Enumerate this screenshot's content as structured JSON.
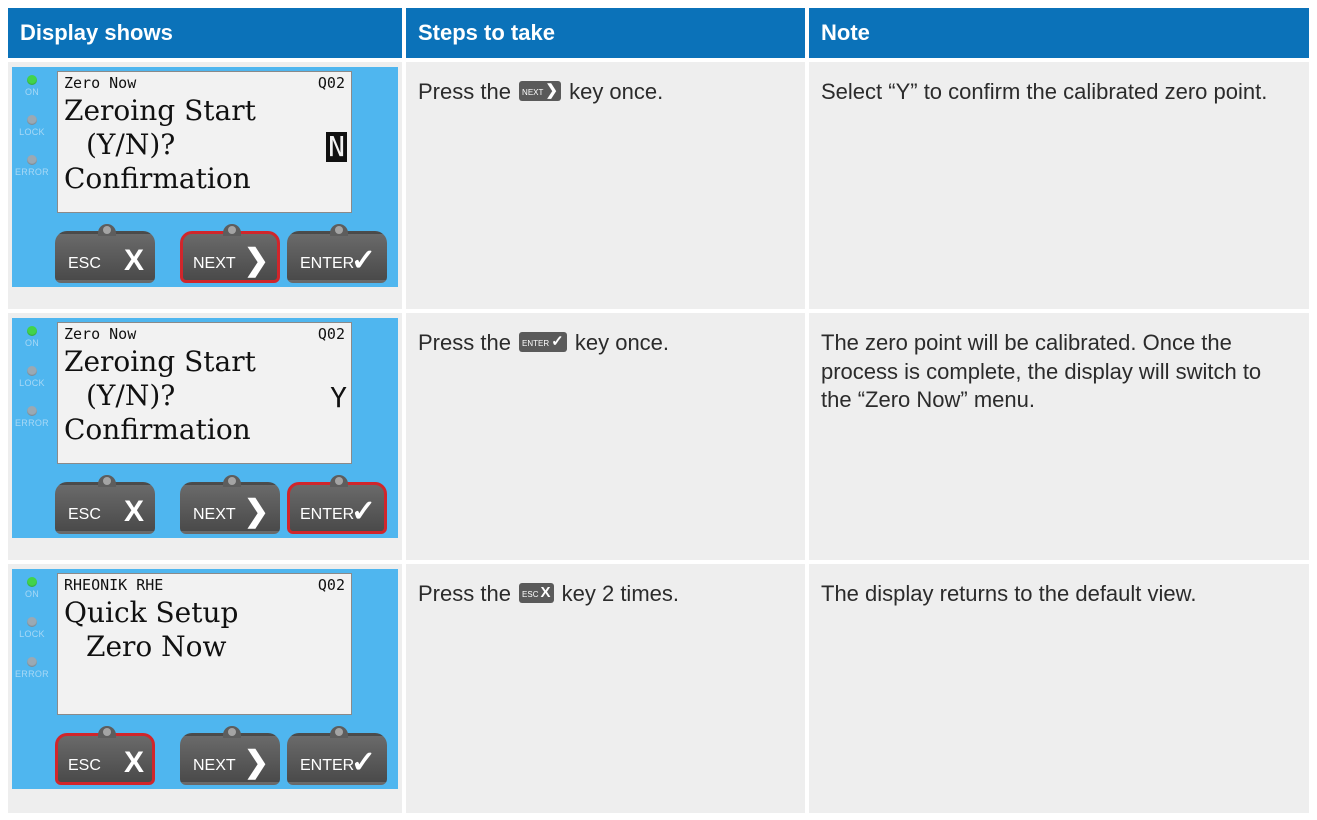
{
  "headers": [
    "Display shows",
    "Steps to take",
    "Note"
  ],
  "led_labels": [
    "ON",
    "LOCK",
    "ERROR"
  ],
  "keys": {
    "esc": {
      "label": "ESC",
      "symbol": "X"
    },
    "next": {
      "label": "NEXT",
      "symbol": "❯"
    },
    "enter": {
      "label": "ENTER",
      "symbol": "✓"
    }
  },
  "rows": [
    {
      "display": {
        "top_left": "Zero Now",
        "top_right": "Q02",
        "line1": "Zeroing Start",
        "line2": "(Y/N)?",
        "choice": "N",
        "line3": "Confirmation",
        "active_key": "next"
      },
      "step_before": "Press the ",
      "step_key": {
        "label": "NEXT",
        "symbol": "❯"
      },
      "step_after": " key once.",
      "note": "Select “Y” to confirm the calibrated zero point."
    },
    {
      "display": {
        "top_left": "Zero Now",
        "top_right": "Q02",
        "line1": "Zeroing Start",
        "line2": "(Y/N)?",
        "choice": "Y",
        "line3": "Confirmation",
        "active_key": "enter"
      },
      "step_before": "Press the ",
      "step_key": {
        "label": "ENTER",
        "symbol": "✓"
      },
      "step_after": " key once.",
      "note": "The zero point will be calibrated. Once the process is complete, the display will switch to the “Zero Now” menu."
    },
    {
      "display": {
        "top_left": "RHEONIK RHE",
        "top_right": "Q02",
        "line1": "Quick Setup",
        "line2": "Zero Now",
        "choice": "",
        "line3": "",
        "active_key": "esc"
      },
      "step_before": "Press the ",
      "step_key": {
        "label": "ESC",
        "symbol": "X"
      },
      "step_after": " key 2 times.",
      "note": "The display returns to the default view."
    }
  ],
  "colors": {
    "header_bg": "#0b72b9",
    "cell_bg": "#eeeeee",
    "device_bg": "#4fb6ef",
    "active_key_border": "#d0262b",
    "led_on": "#42d34b"
  }
}
